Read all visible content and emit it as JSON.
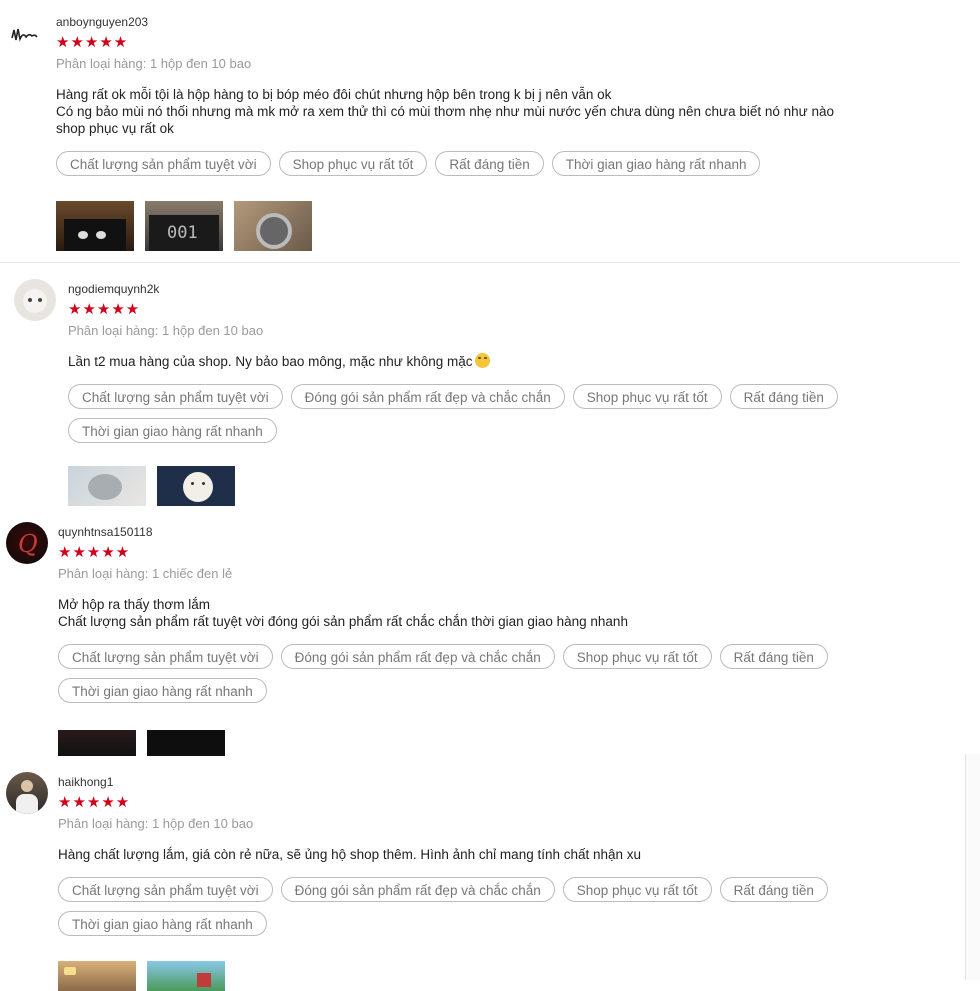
{
  "reviews": [
    {
      "username": "anboynguyen203",
      "rating": 5,
      "stars": "★★★★★",
      "variant": "Phân loại hàng: 1 hộp đen 10 bao",
      "text_lines": [
        "Hàng rất ok mỗi tội là hộp hàng to bị bóp méo đôi chút nhưng hộp bên trong k bị j nên vẫn ok",
        "Có ng bảo mùi nó thối nhưng mà mk mở ra xem thử thì có mùi thơm nhẹ như mùi nước yến chưa dùng nên chưa biết nó như nào",
        "shop phục vụ rất ok"
      ],
      "tags": [
        "Chất lượng sản phẩm tuyệt vời",
        "Shop phục vụ rất tốt",
        "Rất đáng tiền",
        "Thời gian giao hàng rất nhanh"
      ],
      "photos": [
        "dark-box-photo",
        "counter-display-photo",
        "round-item-photo"
      ]
    },
    {
      "username": "ngodiemquynh2k",
      "rating": 5,
      "stars": "★★★★★",
      "variant": "Phân loại hàng: 1 hộp đen 10 bao",
      "text_lines": [
        "Lần t2 mua hàng của shop. Ny bảo bao mông, mặc như không mặc"
      ],
      "tags": [
        "Chất lượng sản phẩm tuyệt vời",
        "Đóng gói sản phẩm rất đẹp và chắc chắn",
        "Shop phục vụ rất tốt",
        "Rất đáng tiền",
        "Thời gian giao hàng rất nhanh"
      ],
      "photos": [
        "cat-photo",
        "cat-photo-2"
      ]
    },
    {
      "username": "quynhtnsa150118",
      "rating": 5,
      "stars": "★★★★★",
      "variant": "Phân loại hàng: 1 chiếc đen lẻ",
      "text_lines": [
        "Mở hộp ra thấy thơm lắm",
        "Chất lượng sản phẩm rất tuyệt vời đóng gói sản phẩm rất chắc chắn thời gian giao hàng nhanh"
      ],
      "tags": [
        "Chất lượng sản phẩm tuyệt vời",
        "Đóng gói sản phẩm rất đẹp và chắc chắn",
        "Shop phục vụ rất tốt",
        "Rất đáng tiền",
        "Thời gian giao hàng rất nhanh"
      ],
      "photos": [
        "dark-photo",
        "dark-photo-2"
      ]
    },
    {
      "username": "haikhong1",
      "rating": 5,
      "stars": "★★★★★",
      "variant": "Phân loại hàng: 1 hộp đen 10 bao",
      "text_lines": [
        "Hàng chất lượng lắm,  giá còn rẻ nữa,  sẽ ủng hộ shop thêm. Hình ảnh chỉ mang tính chất nhận xu"
      ],
      "tags": [
        "Chất lượng sản phẩm tuyệt vời",
        "Đóng gói sản phẩm rất đẹp và chắc chắn",
        "Shop phục vụ rất tốt",
        "Rất đáng tiền",
        "Thời gian giao hàng rất nhanh"
      ],
      "photos": [
        "game-screenshot-photo",
        "game-screenshot-photo-2"
      ]
    }
  ],
  "colors": {
    "star": "#d0011b",
    "tag_border": "#bbbbbb",
    "muted_text": "#9a9a9a"
  }
}
